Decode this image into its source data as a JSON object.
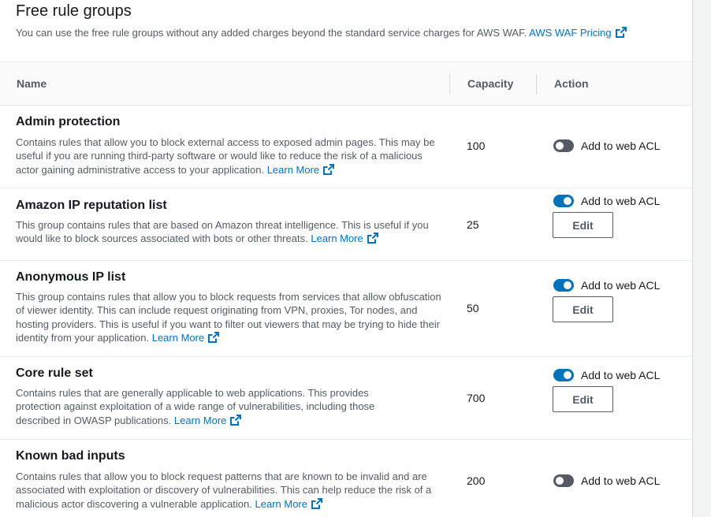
{
  "header": {
    "title": "Free rule groups",
    "description": "You can use the free rule groups without any added charges beyond the standard service charges for AWS WAF.",
    "pricing_link": "AWS WAF Pricing"
  },
  "table": {
    "columns": [
      "Name",
      "Capacity",
      "Action"
    ],
    "learn_more": "Learn More",
    "toggle_label": "Add to web ACL",
    "edit_label": "Edit",
    "rows": [
      {
        "name": "Admin protection",
        "description": "Contains rules that allow you to block external access to exposed admin pages. This may be useful if you are running third-party software or would like to reduce the risk of a malicious actor gaining administrative access to your application.",
        "capacity": "100",
        "enabled": false
      },
      {
        "name": "Amazon IP reputation list",
        "description": "This group contains rules that are based on Amazon threat intelligence. This is useful if you would like to block sources associated with bots or other threats.",
        "capacity": "25",
        "enabled": true
      },
      {
        "name": "Anonymous IP list",
        "description": "This group contains rules that allow you to block requests from services that allow obfuscation of viewer identity. This can include request originating from VPN, proxies, Tor nodes, and hosting providers. This is useful if you want to filter out viewers that may be trying to hide their identity from your application.",
        "capacity": "50",
        "enabled": true
      },
      {
        "name": "Core rule set",
        "description": "Contains rules that are generally applicable to web applications. This provides protection against exploitation of a wide range of vulnerabilities, including those described in OWASP publications.",
        "capacity": "700",
        "enabled": true
      },
      {
        "name": "Known bad inputs",
        "description": "Contains rules that allow you to block request patterns that are known to be invalid and are associated with exploitation or discovery of vulnerabilities. This can help reduce the risk of a malicious actor discovering a vulnerable application.",
        "capacity": "200",
        "enabled": false
      }
    ]
  },
  "colors": {
    "link": "#0073bb",
    "toggle_on": "#0073bb",
    "toggle_off": "#545b64"
  },
  "icons": {
    "external_link": "external-link-icon"
  }
}
